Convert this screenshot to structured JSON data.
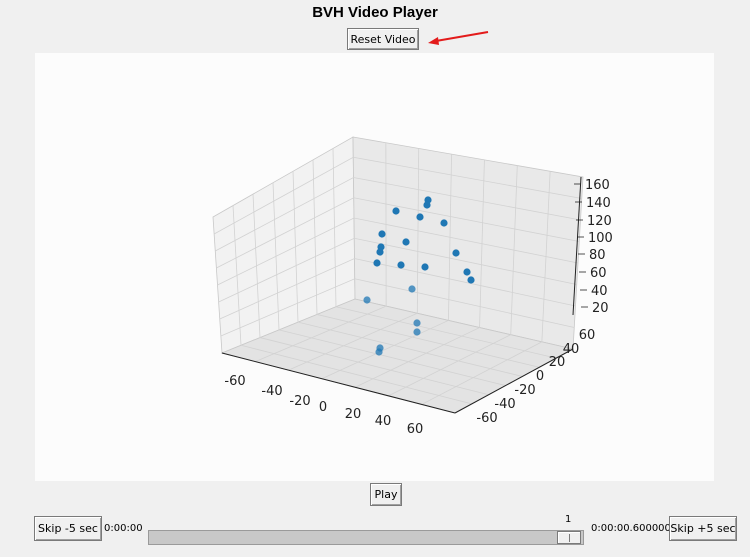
{
  "window": {
    "title": "BVH Video Player"
  },
  "toolbar": {
    "reset_label": "Reset Video",
    "play_label": "Play"
  },
  "controls": {
    "skip_back_label": "Skip -5 sec",
    "skip_forward_label": "Skip +5 sec",
    "time_start": "0:00:00",
    "time_end": "0:00:00.600000",
    "slider_value": "1",
    "slider_fraction": 1.0
  },
  "colors": {
    "point": "#1f77b4",
    "annotation_arrow": "#e31b1b"
  },
  "chart_data": {
    "type": "scatter",
    "projection": "3d",
    "x_ticks": [
      "-60",
      "-40",
      "-20",
      "0",
      "20",
      "40",
      "60"
    ],
    "y_ticks": [
      "-60",
      "-40",
      "-20",
      "0",
      "20",
      "40",
      "60"
    ],
    "z_ticks": [
      "20",
      "40",
      "60",
      "80",
      "100",
      "120",
      "140",
      "160"
    ],
    "points": [
      {
        "x": -5,
        "y": 10,
        "z": 150
      },
      {
        "x": -5,
        "y": 12,
        "z": 145
      },
      {
        "x": -20,
        "y": 5,
        "z": 140
      },
      {
        "x": -8,
        "y": 8,
        "z": 135
      },
      {
        "x": 10,
        "y": 8,
        "z": 130
      },
      {
        "x": -28,
        "y": 5,
        "z": 115
      },
      {
        "x": -12,
        "y": 5,
        "z": 110
      },
      {
        "x": -28,
        "y": 8,
        "z": 100
      },
      {
        "x": -28,
        "y": 10,
        "z": 95
      },
      {
        "x": 15,
        "y": 5,
        "z": 95
      },
      {
        "x": -30,
        "y": 8,
        "z": 85
      },
      {
        "x": -15,
        "y": 5,
        "z": 85
      },
      {
        "x": 0,
        "y": 5,
        "z": 80
      },
      {
        "x": 20,
        "y": 5,
        "z": 75
      },
      {
        "x": 22,
        "y": 5,
        "z": 70
      },
      {
        "x": -5,
        "y": 5,
        "z": 55
      },
      {
        "x": -30,
        "y": 5,
        "z": 50
      },
      {
        "x": -5,
        "y": 5,
        "z": 30
      },
      {
        "x": -5,
        "y": 5,
        "z": 25
      },
      {
        "x": -30,
        "y": 5,
        "z": 15
      },
      {
        "x": -30,
        "y": 5,
        "z": 12
      }
    ]
  }
}
